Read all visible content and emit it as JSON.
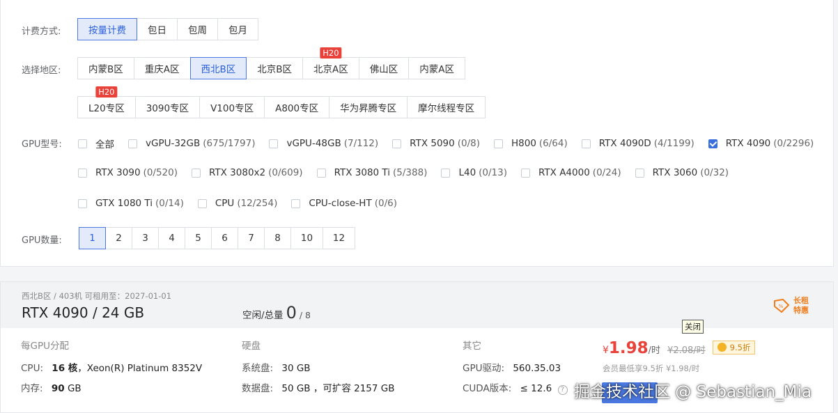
{
  "billing": {
    "label": "计费方式:",
    "options": [
      "按量计费",
      "包日",
      "包周",
      "包月"
    ]
  },
  "region": {
    "label": "选择地区:",
    "row1": [
      "内蒙B区",
      "重庆A区",
      "西北B区",
      "北京B区",
      "北京A区",
      "佛山区",
      "内蒙A区"
    ],
    "row2": [
      "L20专区",
      "3090专区",
      "V100专区",
      "A800专区",
      "华为昇腾专区",
      "摩尔线程专区"
    ],
    "badge": "H20"
  },
  "gpu_model": {
    "label": "GPU型号:",
    "row1": [
      {
        "name": "全部",
        "count": ""
      },
      {
        "name": "vGPU-32GB",
        "count": "(675/1797)"
      },
      {
        "name": "vGPU-48GB",
        "count": "(7/112)"
      },
      {
        "name": "RTX 5090",
        "count": "(0/8)"
      },
      {
        "name": "H800",
        "count": "(6/64)"
      },
      {
        "name": "RTX 4090D",
        "count": "(4/1199)"
      },
      {
        "name": "RTX 4090",
        "count": "(0/2296)"
      }
    ],
    "row2": [
      {
        "name": "RTX 3090",
        "count": "(0/520)"
      },
      {
        "name": "RTX 3080x2",
        "count": "(0/609)"
      },
      {
        "name": "RTX 3080 Ti",
        "count": "(5/388)"
      },
      {
        "name": "L40",
        "count": "(0/13)"
      },
      {
        "name": "RTX A4000",
        "count": "(0/24)"
      },
      {
        "name": "RTX 3060",
        "count": "(0/32)"
      }
    ],
    "row3": [
      {
        "name": "GTX 1080 Ti",
        "count": "(0/14)"
      },
      {
        "name": "CPU",
        "count": "(12/254)"
      },
      {
        "name": "CPU-close-HT",
        "count": "(0/6)"
      }
    ]
  },
  "gpu_count": {
    "label": "GPU数量:",
    "options": [
      "1",
      "2",
      "3",
      "4",
      "5",
      "6",
      "7",
      "8",
      "10",
      "12"
    ]
  },
  "card": {
    "meta": "西北B区 / 403机   可租用至：2027-01-01",
    "model": "RTX 4090 / 24 GB",
    "avail_label": "空闲/总量",
    "avail_free": "0",
    "avail_total": "/ 8",
    "promo_line1": "长租",
    "promo_line2": "特惠",
    "sec_gpu": "每GPU分配",
    "cpu_label": "CPU:",
    "cpu_cores": "16 核",
    "cpu_model": "，Xeon(R) Platinum 8352V",
    "mem_label": "内存:",
    "mem_value": "90",
    "mem_unit": "GB",
    "sec_disk": "硬盘",
    "sys_label": "系统盘:",
    "sys_value": "30 GB",
    "data_label": "数据盘:",
    "data_value": "50 GB ，可扩容 2157 GB",
    "sec_other": "其它",
    "driver_label": "GPU驱动:",
    "driver_value": "560.35.03",
    "cuda_label": "CUDA版本:",
    "cuda_value": "≤ 12.6",
    "close_tip": "关闭",
    "price_currency": "¥",
    "price_value": "1.98",
    "price_unit": "/时",
    "orig_price": "¥2.08/时",
    "discount": "9.5折",
    "member_note": "会员最低享9.5折  ¥1.98/时",
    "watermark": "掘金技术社区 @ Sebastian_Mia"
  }
}
